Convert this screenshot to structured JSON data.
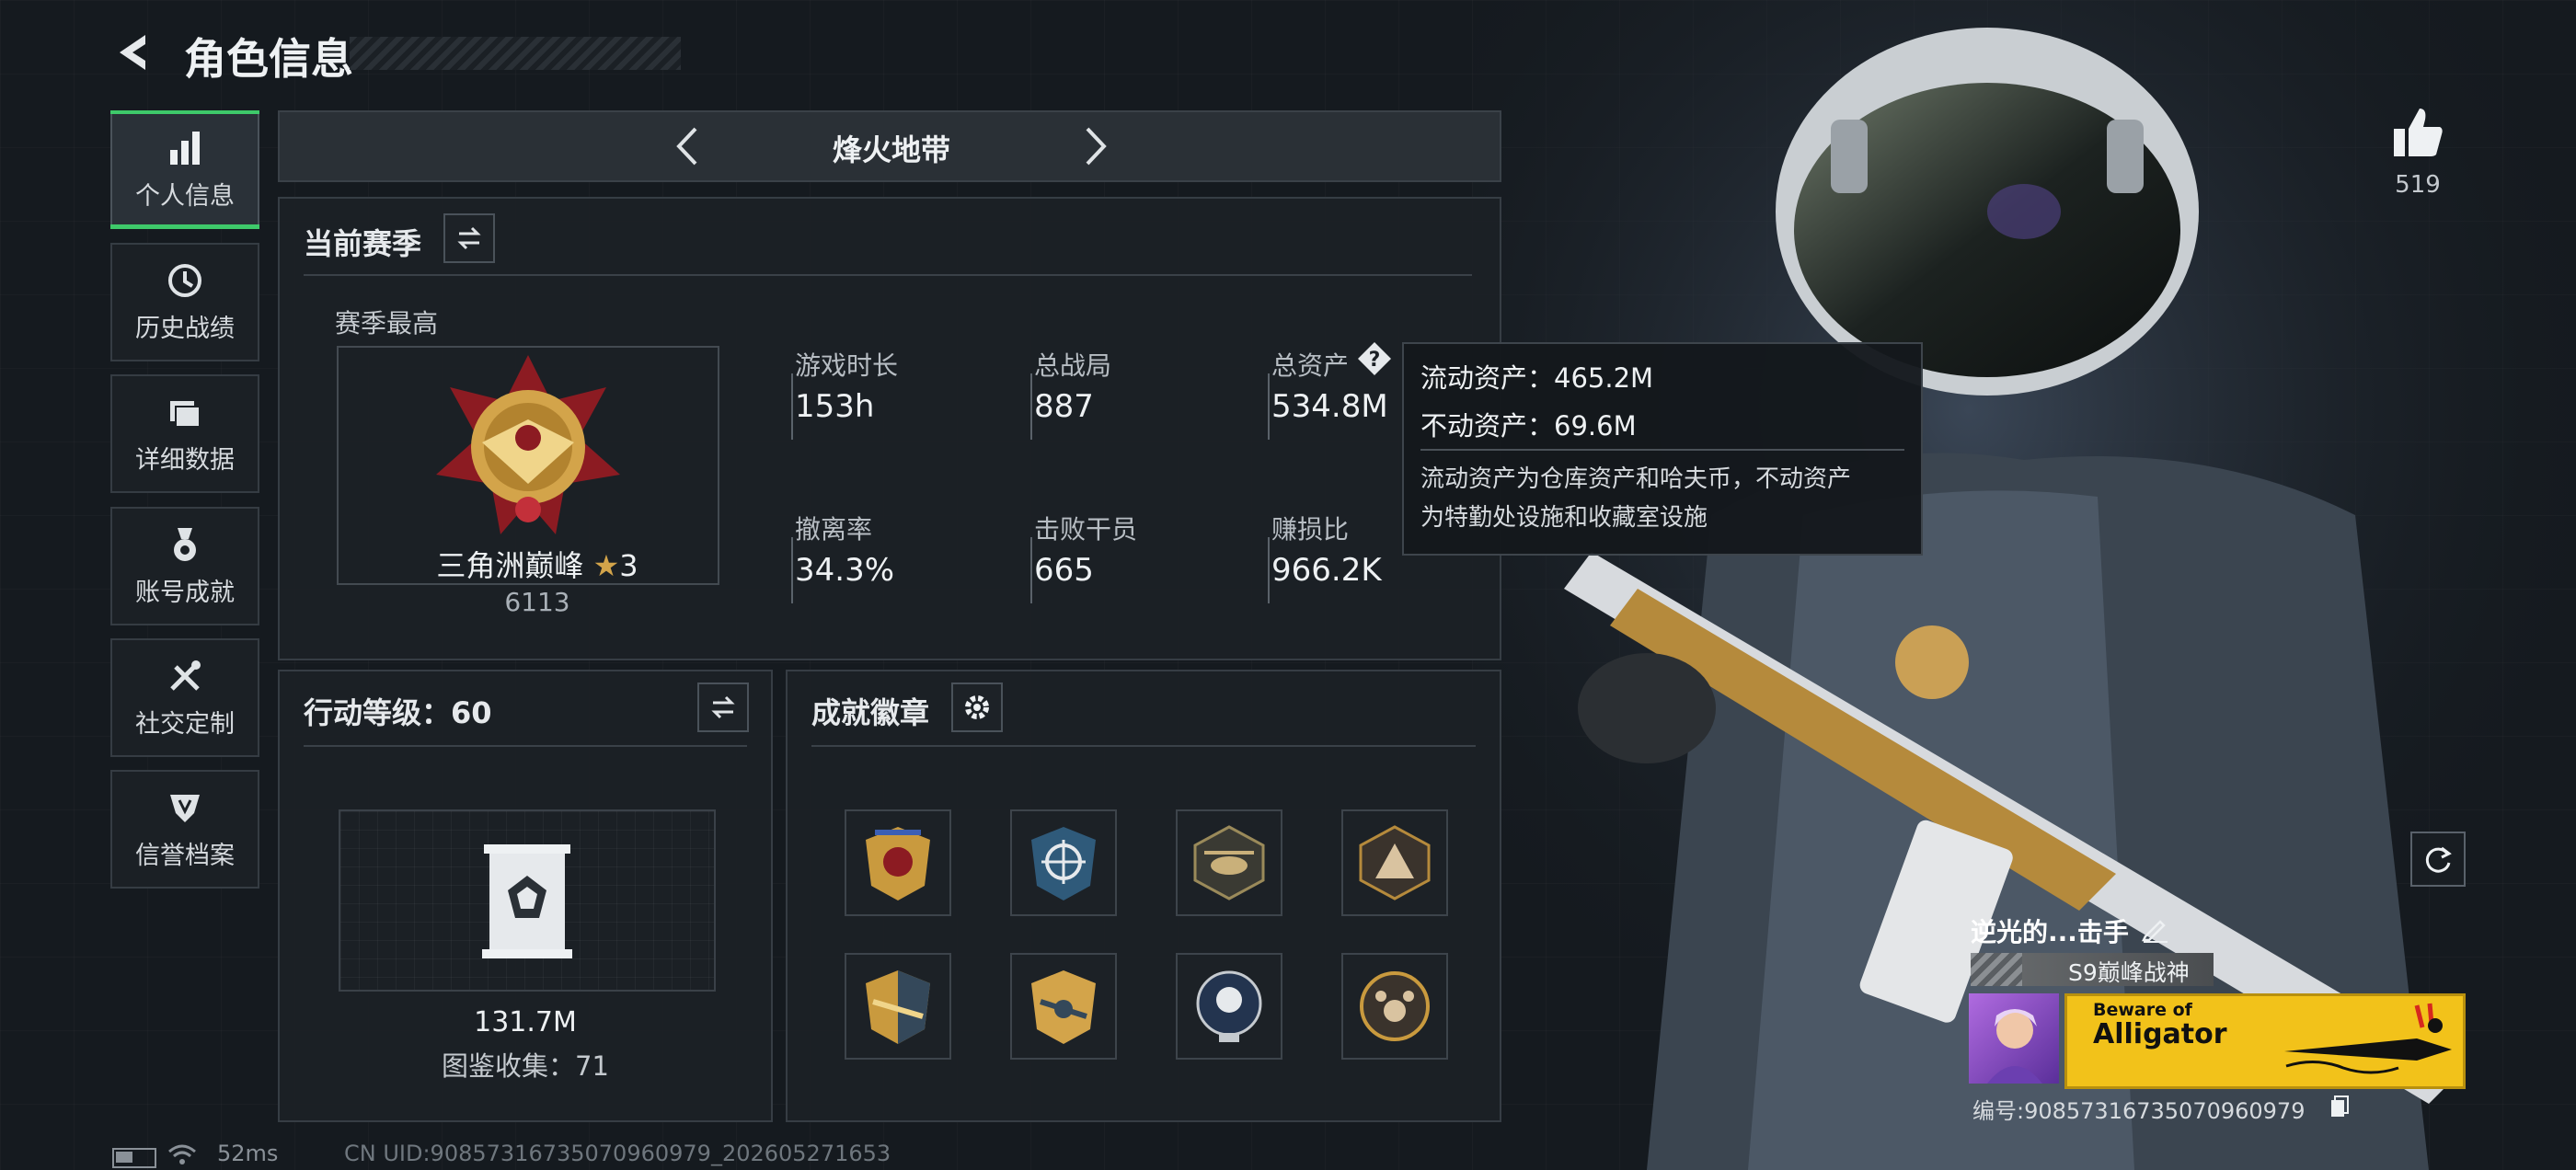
{
  "header": {
    "title": "角色信息"
  },
  "sidebar": {
    "items": [
      {
        "label": "个人信息",
        "icon": "bar-chart-icon",
        "active": true
      },
      {
        "label": "历史战绩",
        "icon": "history-icon"
      },
      {
        "label": "详细数据",
        "icon": "folder-icon"
      },
      {
        "label": "账号成就",
        "icon": "medal-icon"
      },
      {
        "label": "社交定制",
        "icon": "tools-icon"
      },
      {
        "label": "信誉档案",
        "icon": "shield-icon"
      }
    ]
  },
  "mode_selector": {
    "title": "烽火地带"
  },
  "season": {
    "title": "当前赛季",
    "best_label": "赛季最高",
    "rank_name": "三角洲巅峰",
    "rank_stars": "3",
    "rank_points": "6113",
    "stats": [
      {
        "label": "游戏时长",
        "value": "153h"
      },
      {
        "label": "总战局",
        "value": "887"
      },
      {
        "label": "总资产",
        "value": "534.8M"
      },
      {
        "label": "撤离率",
        "value": "34.3%"
      },
      {
        "label": "击败干员",
        "value": "665"
      },
      {
        "label": "赚损比",
        "value": "966.2K"
      }
    ]
  },
  "tooltip": {
    "line1": "流动资产：465.2M",
    "line2": "不动资产：69.6M",
    "desc1": "流动资产为仓库资产和哈夫币，不动资产",
    "desc2": "为特勤处设施和收藏室设施"
  },
  "action_level": {
    "title": "行动等级：60",
    "value": "131.7M",
    "collection": "图鉴收集：71"
  },
  "achievements": {
    "title": "成就徽章",
    "badges": [
      "eagle-badge-icon",
      "crosshair-badge-icon",
      "helicopter-badge-icon",
      "triangle-badge-icon",
      "wings-badge-icon",
      "gold-wings-badge-icon",
      "skull-badge-icon",
      "paw-badge-icon"
    ]
  },
  "profile": {
    "likes": "519",
    "player_name": "逆光的...击手",
    "title_tag": "S9巅峰战神",
    "banner_top": "Beware of",
    "banner_main": "Alligator",
    "id_label": "编号:90857316735070960979"
  },
  "footer": {
    "ping": "52ms",
    "uid": "CN UID:90857316735070960979_202605271653"
  },
  "colors": {
    "accent_green": "#3ec96a",
    "banner_yellow": "#f2c21a",
    "gold": "#c99a3e"
  }
}
